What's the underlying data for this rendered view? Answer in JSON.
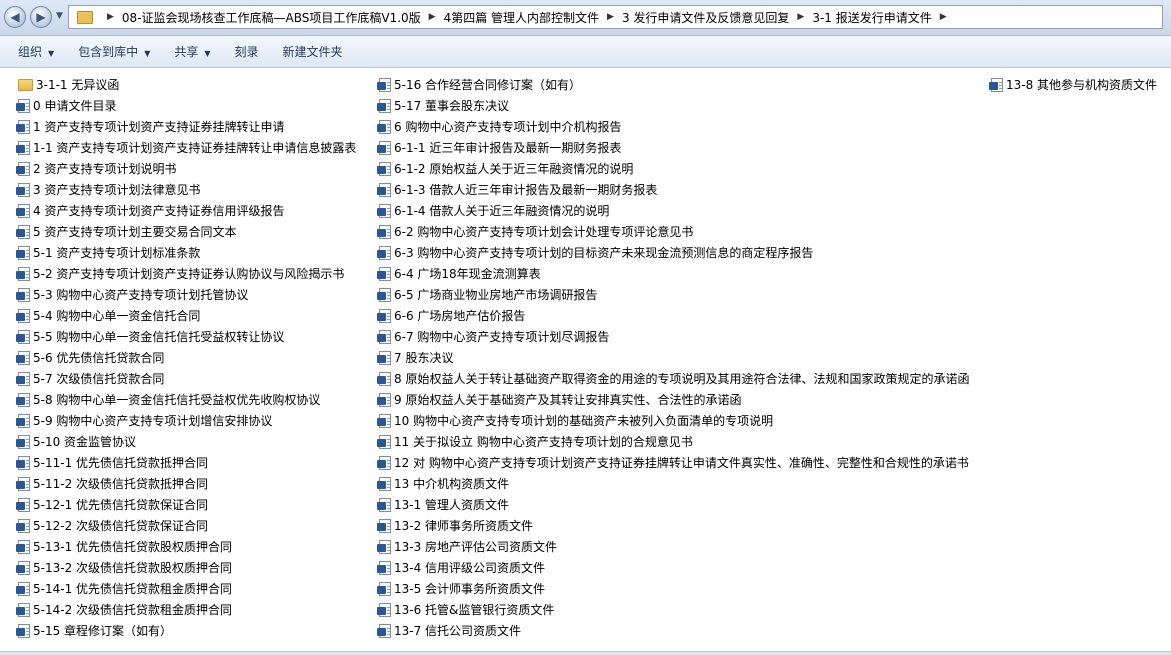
{
  "address": {
    "crumbs": [
      "08-证监会现场核查工作底稿—ABS项目工作底稿V1.0版",
      "4第四篇  管理人内部控制文件",
      "3 发行申请文件及反馈意见回复",
      "3-1 报送发行申请文件"
    ]
  },
  "toolbar": {
    "organize": "组织",
    "include_library": "包含到库中",
    "share": "共享",
    "burn": "刻录",
    "new_folder": "新建文件夹"
  },
  "files": {
    "col1": [
      {
        "label": "3-1-1 无异议函",
        "icon": "folder-icon"
      },
      {
        "label": "0 申请文件目录",
        "icon": "word-doc-icon"
      },
      {
        "label": "1 资产支持专项计划资产支持证券挂牌转让申请",
        "icon": "word-doc-icon"
      },
      {
        "label": "1-1 资产支持专项计划资产支持证券挂牌转让申请信息披露表",
        "icon": "word-doc-icon"
      },
      {
        "label": "2 资产支持专项计划说明书",
        "icon": "word-doc-icon"
      },
      {
        "label": "3 资产支持专项计划法律意见书",
        "icon": "word-doc-icon"
      },
      {
        "label": "4 资产支持专项计划资产支持证券信用评级报告",
        "icon": "word-doc-icon"
      },
      {
        "label": "5 资产支持专项计划主要交易合同文本",
        "icon": "word-doc-icon"
      },
      {
        "label": "5-1 资产支持专项计划标准条款",
        "icon": "word-doc-icon"
      },
      {
        "label": "5-2 资产支持专项计划资产支持证券认购协议与风险揭示书",
        "icon": "word-doc-icon"
      },
      {
        "label": "5-3 购物中心资产支持专项计划托管协议",
        "icon": "word-doc-icon"
      },
      {
        "label": "5-4 购物中心单一资金信托合同",
        "icon": "word-doc-icon"
      },
      {
        "label": "5-5 购物中心单一资金信托信托受益权转让协议",
        "icon": "word-doc-icon"
      },
      {
        "label": "5-6 优先债信托贷款合同",
        "icon": "word-doc-icon"
      },
      {
        "label": "5-7 次级债信托贷款合同",
        "icon": "word-doc-icon"
      },
      {
        "label": "5-8 购物中心单一资金信托信托受益权优先收购权协议",
        "icon": "word-doc-icon"
      },
      {
        "label": "5-9 购物中心资产支持专项计划增信安排协议",
        "icon": "word-doc-icon"
      },
      {
        "label": "5-10 资金监管协议",
        "icon": "word-doc-icon"
      },
      {
        "label": "5-11-1 优先债信托贷款抵押合同",
        "icon": "word-doc-icon"
      },
      {
        "label": "5-11-2 次级债信托贷款抵押合同",
        "icon": "word-doc-icon"
      },
      {
        "label": "5-12-1 优先债信托贷款保证合同",
        "icon": "word-doc-icon"
      },
      {
        "label": "5-12-2 次级债信托贷款保证合同",
        "icon": "word-doc-icon"
      },
      {
        "label": "5-13-1 优先债信托贷款股权质押合同",
        "icon": "word-doc-icon"
      },
      {
        "label": "5-13-2 次级债信托贷款股权质押合同",
        "icon": "word-doc-icon"
      },
      {
        "label": "5-14-1 优先债信托贷款租金质押合同",
        "icon": "word-doc-icon"
      },
      {
        "label": "5-14-2 次级债信托贷款租金质押合同",
        "icon": "word-doc-icon"
      },
      {
        "label": "5-15 章程修订案（如有）",
        "icon": "word-doc-icon"
      }
    ],
    "col2": [
      {
        "label": "5-16 合作经营合同修订案（如有）",
        "icon": "word-doc-icon"
      },
      {
        "label": "5-17 董事会股东决议",
        "icon": "word-doc-icon"
      },
      {
        "label": "6 购物中心资产支持专项计划中介机构报告",
        "icon": "word-doc-icon"
      },
      {
        "label": "6-1-1 近三年审计报告及最新一期财务报表",
        "icon": "word-doc-icon"
      },
      {
        "label": "6-1-2 原始权益人关于近三年融资情况的说明",
        "icon": "word-doc-icon"
      },
      {
        "label": "6-1-3 借款人近三年审计报告及最新一期财务报表",
        "icon": "word-doc-icon"
      },
      {
        "label": "6-1-4 借款人关于近三年融资情况的说明",
        "icon": "word-doc-icon"
      },
      {
        "label": "6-2  购物中心资产支持专项计划会计处理专项评论意见书",
        "icon": "word-doc-icon"
      },
      {
        "label": "6-3 购物中心资产支持专项计划的目标资产未来现金流预测信息的商定程序报告",
        "icon": "word-doc-icon"
      },
      {
        "label": "6-4 广场18年现金流测算表",
        "icon": "word-doc-icon"
      },
      {
        "label": "6-5 广场商业物业房地产市场调研报告",
        "icon": "word-doc-icon"
      },
      {
        "label": "6-6 广场房地产估价报告",
        "icon": "word-doc-icon"
      },
      {
        "label": "6-7 购物中心资产支持专项计划尽调报告",
        "icon": "word-doc-icon"
      },
      {
        "label": "7 股东决议",
        "icon": "word-doc-icon"
      },
      {
        "label": "8 原始权益人关于转让基础资产取得资金的用途的专项说明及其用途符合法律、法规和国家政策规定的承诺函",
        "icon": "word-doc-icon"
      },
      {
        "label": "9 原始权益人关于基础资产及其转让安排真实性、合法性的承诺函",
        "icon": "word-doc-icon"
      },
      {
        "label": "10 购物中心资产支持专项计划的基础资产未被列入负面清单的专项说明",
        "icon": "word-doc-icon"
      },
      {
        "label": "11 关于拟设立 购物中心资产支持专项计划的合规意见书",
        "icon": "word-doc-icon"
      },
      {
        "label": "12 对 购物中心资产支持专项计划资产支持证券挂牌转让申请文件真实性、准确性、完整性和合规性的承诺书",
        "icon": "word-doc-icon"
      },
      {
        "label": "13 中介机构资质文件",
        "icon": "word-doc-icon"
      },
      {
        "label": "13-1 管理人资质文件",
        "icon": "word-doc-icon"
      },
      {
        "label": "13-2 律师事务所资质文件",
        "icon": "word-doc-icon"
      },
      {
        "label": "13-3 房地产评估公司资质文件",
        "icon": "word-doc-icon"
      },
      {
        "label": "13-4 信用评级公司资质文件",
        "icon": "word-doc-icon"
      },
      {
        "label": "13-5 会计师事务所资质文件",
        "icon": "word-doc-icon"
      },
      {
        "label": "13-6 托管&监管银行资质文件",
        "icon": "word-doc-icon"
      },
      {
        "label": "13-7 信托公司资质文件",
        "icon": "word-doc-icon"
      }
    ],
    "col3": [
      {
        "label": "13-8 其他参与机构资质文件",
        "icon": "word-doc-icon"
      }
    ]
  }
}
